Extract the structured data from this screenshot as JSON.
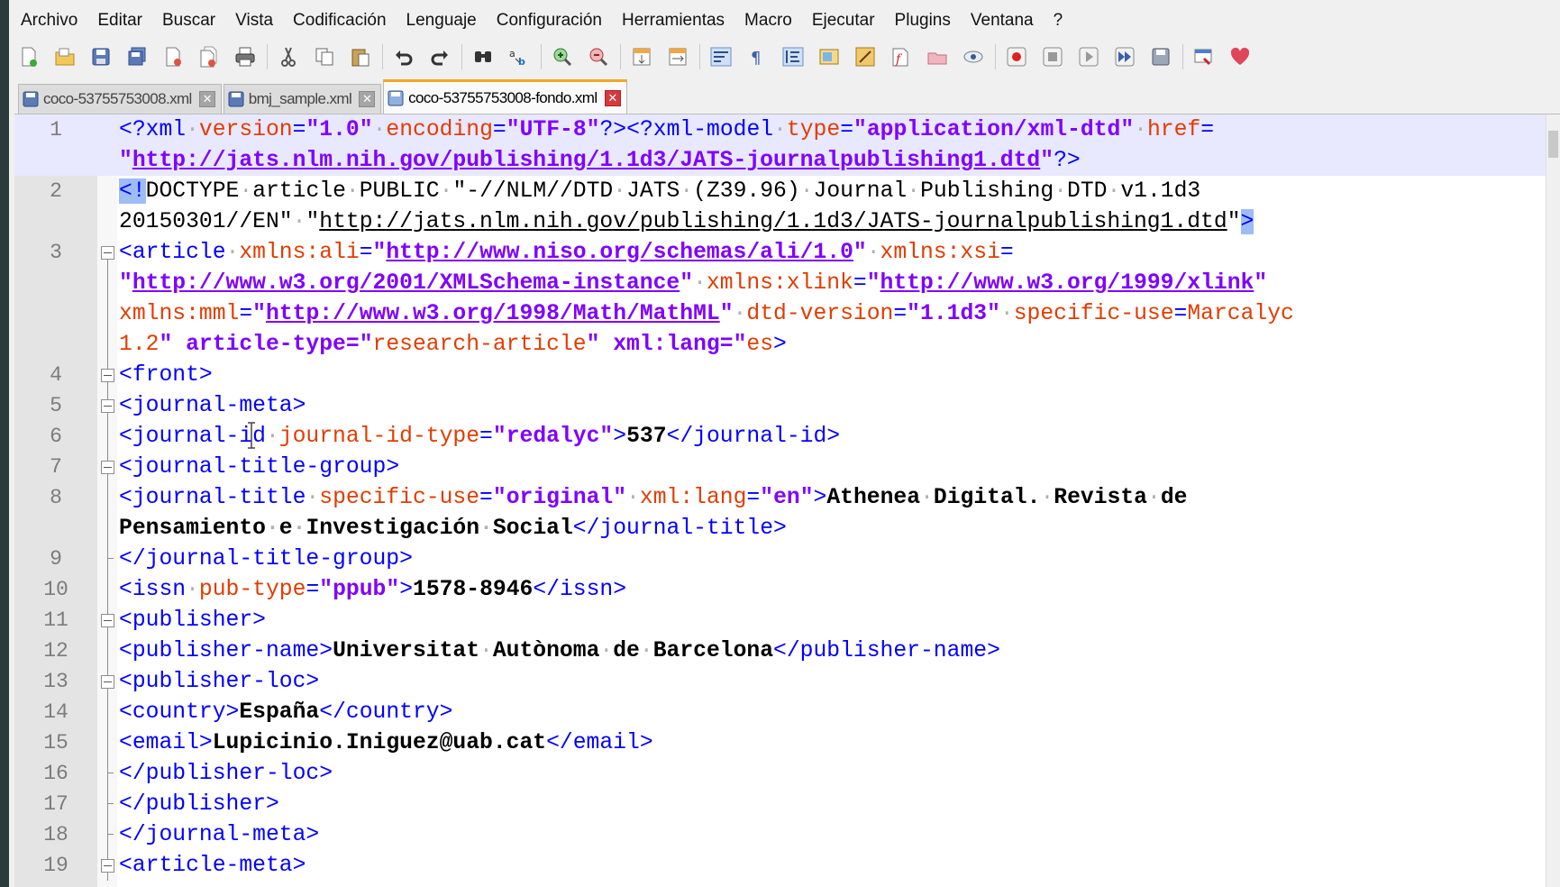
{
  "menu": [
    "Archivo",
    "Editar",
    "Buscar",
    "Vista",
    "Codificación",
    "Lenguaje",
    "Configuración",
    "Herramientas",
    "Macro",
    "Ejecutar",
    "Plugins",
    "Ventana",
    "?"
  ],
  "toolbar_icons": [
    "new-file-icon",
    "open-file-icon",
    "save-icon",
    "save-all-icon",
    "close-icon",
    "close-all-icon",
    "print-icon",
    "cut-icon",
    "copy-icon",
    "paste-icon",
    "undo-icon",
    "redo-icon",
    "find-icon",
    "replace-icon",
    "zoom-in-icon",
    "zoom-out-icon",
    "sync-vertical-icon",
    "sync-horizontal-icon",
    "word-wrap-icon",
    "show-all-chars-icon",
    "indent-guide-icon",
    "doc-map-icon",
    "function-list-icon",
    "folder-workspace-icon",
    "monitor-icon",
    "record-macro-icon",
    "stop-macro-icon",
    "play-macro-icon",
    "run-macro-multiple-icon",
    "save-macro-icon",
    "plugin-icon",
    "heart-icon"
  ],
  "tabs": [
    {
      "label": "coco-53755753008.xml",
      "active": false
    },
    {
      "label": "bmj_sample.xml",
      "active": false
    },
    {
      "label": "coco-53755753008-fondo.xml",
      "active": true
    }
  ],
  "lines": [
    {
      "num": "1",
      "fold": "none",
      "text": "<?xml version=\"1.0\" encoding=\"UTF-8\"?><?xml-model type=\"application/xml-dtd\" href="
    },
    {
      "num": "",
      "fold": "none",
      "text": "\"http://jats.nlm.nih.gov/publishing/1.1d3/JATS-journalpublishing1.dtd\"?>"
    },
    {
      "num": "2",
      "fold": "none",
      "text": "<!DOCTYPE article PUBLIC \"-//NLM//DTD JATS (Z39.96) Journal Publishing DTD v1.1d3"
    },
    {
      "num": "",
      "fold": "none",
      "text": "20150301//EN\" \"http://jats.nlm.nih.gov/publishing/1.1d3/JATS-journalpublishing1.dtd\">"
    },
    {
      "num": "3",
      "fold": "open",
      "text": "<article xmlns:ali=\"http://www.niso.org/schemas/ali/1.0\" xmlns:xsi="
    },
    {
      "num": "",
      "fold": "line",
      "text": "\"http://www.w3.org/2001/XMLSchema-instance\" xmlns:xlink=\"http://www.w3.org/1999/xlink\""
    },
    {
      "num": "",
      "fold": "line",
      "text": "xmlns:mml=\"http://www.w3.org/1998/Math/MathML\" dtd-version=\"1.1d3\" specific-use=\"Marcalyc"
    },
    {
      "num": "",
      "fold": "line",
      "text": "1.2\" article-type=\"research-article\" xml:lang=\"es\">"
    },
    {
      "num": "4",
      "fold": "open",
      "text": "<front>"
    },
    {
      "num": "5",
      "fold": "open",
      "text": "<journal-meta>"
    },
    {
      "num": "6",
      "fold": "line",
      "text": "<journal-id journal-id-type=\"redalyc\">537</journal-id>"
    },
    {
      "num": "7",
      "fold": "open",
      "text": "<journal-title-group>"
    },
    {
      "num": "8",
      "fold": "line",
      "text": "<journal-title specific-use=\"original\" xml:lang=\"en\">Athenea Digital. Revista de"
    },
    {
      "num": "",
      "fold": "line",
      "text": "Pensamiento e Investigación Social</journal-title>"
    },
    {
      "num": "9",
      "fold": "end",
      "text": "</journal-title-group>"
    },
    {
      "num": "10",
      "fold": "line",
      "text": "<issn pub-type=\"ppub\">1578-8946</issn>"
    },
    {
      "num": "11",
      "fold": "open",
      "text": "<publisher>"
    },
    {
      "num": "12",
      "fold": "line",
      "text": "<publisher-name>Universitat Autònoma de Barcelona</publisher-name>"
    },
    {
      "num": "13",
      "fold": "open",
      "text": "<publisher-loc>"
    },
    {
      "num": "14",
      "fold": "line",
      "text": "<country>España</country>"
    },
    {
      "num": "15",
      "fold": "line",
      "text": "<email>Lupicinio.Iniguez@uab.cat</email>"
    },
    {
      "num": "16",
      "fold": "end",
      "text": "</publisher-loc>"
    },
    {
      "num": "17",
      "fold": "end",
      "text": "</publisher>"
    },
    {
      "num": "18",
      "fold": "end",
      "text": "</journal-meta>"
    },
    {
      "num": "19",
      "fold": "open",
      "text": "<article-meta>"
    }
  ]
}
